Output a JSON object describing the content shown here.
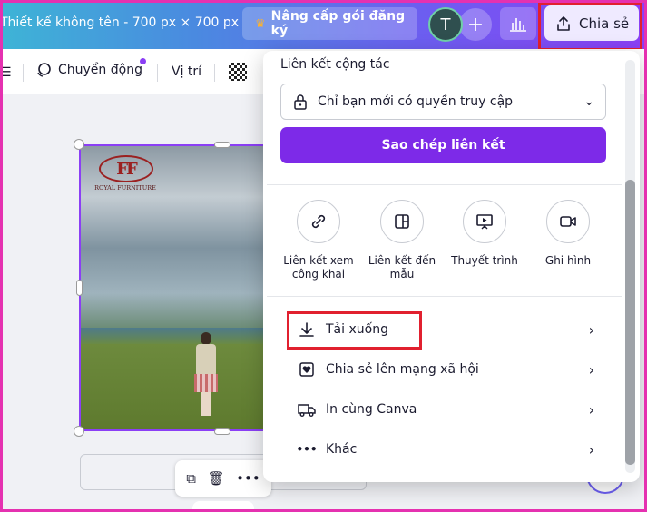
{
  "topbar": {
    "doc_title": "Thiết kế không tên - 700 px × 700 px",
    "upgrade_label": "Nâng cấp gói đăng ký",
    "avatar_letter": "T",
    "plus_label": "+",
    "share_label": "Chia sẻ"
  },
  "toolbar": {
    "motion_label": "Chuyển động",
    "position_label": "Vị trí"
  },
  "canvas": {
    "logo_mark": "FF",
    "logo_text": "ROYAL FURNITURE"
  },
  "share_panel": {
    "title": "Liên kết cộng tác",
    "access_value": "Chỉ bạn mới có quyền truy cập",
    "copy_link_label": "Sao chép liên kết",
    "options": [
      {
        "label": "Liên kết xem công khai",
        "icon": "link-icon"
      },
      {
        "label": "Liên kết đến mẫu",
        "icon": "template-icon"
      },
      {
        "label": "Thuyết trình",
        "icon": "present-icon"
      },
      {
        "label": "Ghi hình",
        "icon": "camera-icon"
      }
    ],
    "rows": [
      {
        "label": "Tải xuống",
        "icon": "download-icon"
      },
      {
        "label": "Chia sẻ lên mạng xã hội",
        "icon": "heart-icon"
      },
      {
        "label": "In cùng Canva",
        "icon": "truck-icon"
      },
      {
        "label": "Khác",
        "icon": "more-icon"
      }
    ]
  },
  "colors": {
    "accent": "#7d2ae8",
    "highlight": "#e1202f",
    "frame": "#e531b0"
  }
}
